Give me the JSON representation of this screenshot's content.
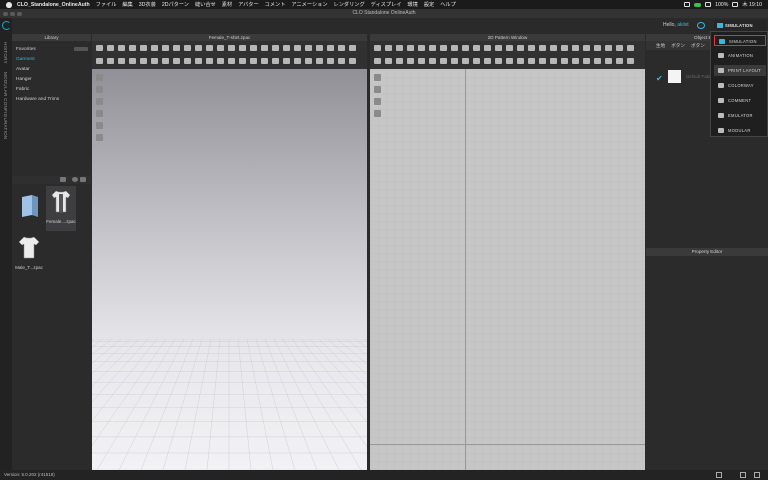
{
  "menubar": {
    "app_name": "CLO_Standalone_OnlineAuth",
    "items": [
      "ファイル",
      "編集",
      "3D衣装",
      "2Dパターン",
      "縫い合せ",
      "素材",
      "アバター",
      "コメント",
      "アニメーション",
      "レンダリング",
      "ディスプレイ",
      "環境",
      "設定",
      "ヘルプ"
    ],
    "battery": "100%",
    "clock": "木 19:10"
  },
  "window": {
    "title": "CLO Standalone OnlineAuth"
  },
  "rail": {
    "history_label": "HISTORY",
    "modular_label": "MODULAR CONFIGURATION"
  },
  "header": {
    "hello": "Hello,",
    "user": "akiist"
  },
  "library": {
    "title": "Library",
    "items": [
      "Favorites",
      "Garment",
      "Avatar",
      "Hanger",
      "Fabric",
      "Hardware and Trims"
    ],
    "files": [
      "",
      "Female....zpac",
      "Male_T...zpac"
    ]
  },
  "window3d": {
    "title": "Female_T-shirt.zpac"
  },
  "window2d": {
    "title": "2D Pattern Window"
  },
  "object_browser": {
    "title": "Object B",
    "tabs": [
      "生地",
      "ボタン",
      "ボタン"
    ],
    "fabric_name": "Default Fabric"
  },
  "property_editor": {
    "title": "Property Editor"
  },
  "mode": {
    "current": "SIMULATION",
    "options": [
      "SIMULATION",
      "ANIMATION",
      "PRINT LAYOUT",
      "COLORWAY",
      "COMMENT",
      "EMULATOR",
      "MODULAR"
    ]
  },
  "footer": {
    "version": "Version: 5.0.202 (r41518)"
  },
  "colors": {
    "accent": "#36b9e0",
    "highlight_border": "#dd3333"
  },
  "icons": [
    "apple-icon",
    "wifi-icon",
    "battery-icon",
    "clo-logo-icon",
    "mode-switch-icon",
    "search-icon",
    "refresh-icon"
  ]
}
